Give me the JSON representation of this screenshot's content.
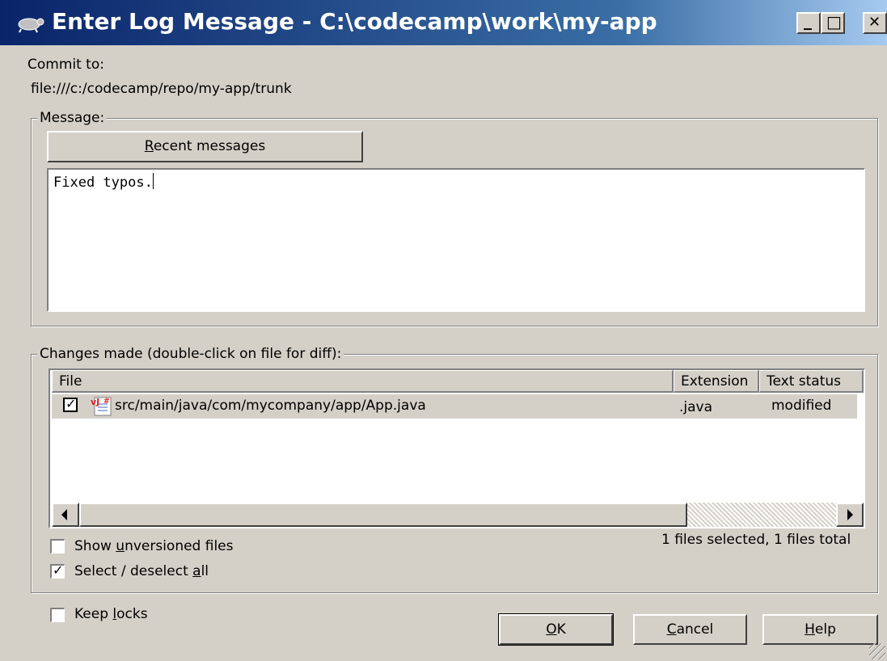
{
  "window": {
    "title": "Enter Log Message - C:\\codecamp\\work\\my-app",
    "minimize_glyph": "_",
    "maximize_glyph": "□",
    "close_glyph": "✕"
  },
  "commit": {
    "label": "Commit to:",
    "url": "file:///c:/codecamp/repo/my-app/trunk"
  },
  "message": {
    "group_label": "Message:",
    "recent_button": {
      "pre": "",
      "mnemonic": "R",
      "post": "ecent messages"
    },
    "text": "Fixed typos."
  },
  "changes": {
    "group_label": "Changes made (double-click on file for diff):",
    "columns": [
      "File",
      "Extension",
      "Text status"
    ],
    "rows": [
      {
        "checked": true,
        "file": "src/main/java/com/mycompany/app/App.java",
        "extension": ".java",
        "status": "modified",
        "file_icon": "java-file-icon"
      }
    ],
    "selection_summary": "1 files selected, 1 files total",
    "show_unversioned": {
      "checked": false,
      "pre": "Show ",
      "mnemonic": "u",
      "post": "nversioned files"
    },
    "select_all": {
      "checked": true,
      "pre": "Select / deselect ",
      "mnemonic": "a",
      "post": "ll"
    }
  },
  "keep_locks": {
    "checked": false,
    "pre": "Keep ",
    "mnemonic": "l",
    "post": "ocks"
  },
  "buttons": {
    "ok": {
      "pre": "",
      "mnemonic": "O",
      "post": "K"
    },
    "cancel": {
      "pre": "",
      "mnemonic": "C",
      "post": "ancel"
    },
    "help": {
      "pre": "",
      "mnemonic": "H",
      "post": "elp"
    }
  },
  "colors": {
    "titlebar_start": "#0a246a",
    "titlebar_end": "#a6caf0",
    "dialog_bg": "#d4d0c8"
  }
}
